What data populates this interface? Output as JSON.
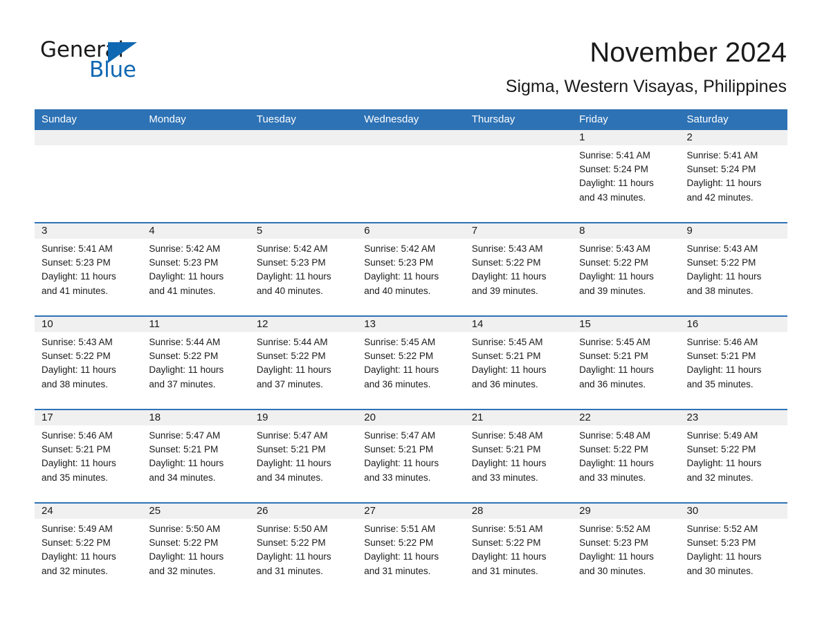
{
  "brand": {
    "name_part1": "General",
    "name_part2": "Blue",
    "accent_color": "#1068b3",
    "triangle_icon": "triangle-icon"
  },
  "header": {
    "title": "November 2024",
    "subtitle": "Sigma, Western Visayas, Philippines"
  },
  "calendar": {
    "header_color": "#2d72b5",
    "weekdays": [
      "Sunday",
      "Monday",
      "Tuesday",
      "Wednesday",
      "Thursday",
      "Friday",
      "Saturday"
    ],
    "weeks": [
      [
        {
          "day": "",
          "sunrise": "",
          "sunset": "",
          "daylight1": "",
          "daylight2": ""
        },
        {
          "day": "",
          "sunrise": "",
          "sunset": "",
          "daylight1": "",
          "daylight2": ""
        },
        {
          "day": "",
          "sunrise": "",
          "sunset": "",
          "daylight1": "",
          "daylight2": ""
        },
        {
          "day": "",
          "sunrise": "",
          "sunset": "",
          "daylight1": "",
          "daylight2": ""
        },
        {
          "day": "",
          "sunrise": "",
          "sunset": "",
          "daylight1": "",
          "daylight2": ""
        },
        {
          "day": "1",
          "sunrise": "Sunrise: 5:41 AM",
          "sunset": "Sunset: 5:24 PM",
          "daylight1": "Daylight: 11 hours",
          "daylight2": "and 43 minutes."
        },
        {
          "day": "2",
          "sunrise": "Sunrise: 5:41 AM",
          "sunset": "Sunset: 5:24 PM",
          "daylight1": "Daylight: 11 hours",
          "daylight2": "and 42 minutes."
        }
      ],
      [
        {
          "day": "3",
          "sunrise": "Sunrise: 5:41 AM",
          "sunset": "Sunset: 5:23 PM",
          "daylight1": "Daylight: 11 hours",
          "daylight2": "and 41 minutes."
        },
        {
          "day": "4",
          "sunrise": "Sunrise: 5:42 AM",
          "sunset": "Sunset: 5:23 PM",
          "daylight1": "Daylight: 11 hours",
          "daylight2": "and 41 minutes."
        },
        {
          "day": "5",
          "sunrise": "Sunrise: 5:42 AM",
          "sunset": "Sunset: 5:23 PM",
          "daylight1": "Daylight: 11 hours",
          "daylight2": "and 40 minutes."
        },
        {
          "day": "6",
          "sunrise": "Sunrise: 5:42 AM",
          "sunset": "Sunset: 5:23 PM",
          "daylight1": "Daylight: 11 hours",
          "daylight2": "and 40 minutes."
        },
        {
          "day": "7",
          "sunrise": "Sunrise: 5:43 AM",
          "sunset": "Sunset: 5:22 PM",
          "daylight1": "Daylight: 11 hours",
          "daylight2": "and 39 minutes."
        },
        {
          "day": "8",
          "sunrise": "Sunrise: 5:43 AM",
          "sunset": "Sunset: 5:22 PM",
          "daylight1": "Daylight: 11 hours",
          "daylight2": "and 39 minutes."
        },
        {
          "day": "9",
          "sunrise": "Sunrise: 5:43 AM",
          "sunset": "Sunset: 5:22 PM",
          "daylight1": "Daylight: 11 hours",
          "daylight2": "and 38 minutes."
        }
      ],
      [
        {
          "day": "10",
          "sunrise": "Sunrise: 5:43 AM",
          "sunset": "Sunset: 5:22 PM",
          "daylight1": "Daylight: 11 hours",
          "daylight2": "and 38 minutes."
        },
        {
          "day": "11",
          "sunrise": "Sunrise: 5:44 AM",
          "sunset": "Sunset: 5:22 PM",
          "daylight1": "Daylight: 11 hours",
          "daylight2": "and 37 minutes."
        },
        {
          "day": "12",
          "sunrise": "Sunrise: 5:44 AM",
          "sunset": "Sunset: 5:22 PM",
          "daylight1": "Daylight: 11 hours",
          "daylight2": "and 37 minutes."
        },
        {
          "day": "13",
          "sunrise": "Sunrise: 5:45 AM",
          "sunset": "Sunset: 5:22 PM",
          "daylight1": "Daylight: 11 hours",
          "daylight2": "and 36 minutes."
        },
        {
          "day": "14",
          "sunrise": "Sunrise: 5:45 AM",
          "sunset": "Sunset: 5:21 PM",
          "daylight1": "Daylight: 11 hours",
          "daylight2": "and 36 minutes."
        },
        {
          "day": "15",
          "sunrise": "Sunrise: 5:45 AM",
          "sunset": "Sunset: 5:21 PM",
          "daylight1": "Daylight: 11 hours",
          "daylight2": "and 36 minutes."
        },
        {
          "day": "16",
          "sunrise": "Sunrise: 5:46 AM",
          "sunset": "Sunset: 5:21 PM",
          "daylight1": "Daylight: 11 hours",
          "daylight2": "and 35 minutes."
        }
      ],
      [
        {
          "day": "17",
          "sunrise": "Sunrise: 5:46 AM",
          "sunset": "Sunset: 5:21 PM",
          "daylight1": "Daylight: 11 hours",
          "daylight2": "and 35 minutes."
        },
        {
          "day": "18",
          "sunrise": "Sunrise: 5:47 AM",
          "sunset": "Sunset: 5:21 PM",
          "daylight1": "Daylight: 11 hours",
          "daylight2": "and 34 minutes."
        },
        {
          "day": "19",
          "sunrise": "Sunrise: 5:47 AM",
          "sunset": "Sunset: 5:21 PM",
          "daylight1": "Daylight: 11 hours",
          "daylight2": "and 34 minutes."
        },
        {
          "day": "20",
          "sunrise": "Sunrise: 5:47 AM",
          "sunset": "Sunset: 5:21 PM",
          "daylight1": "Daylight: 11 hours",
          "daylight2": "and 33 minutes."
        },
        {
          "day": "21",
          "sunrise": "Sunrise: 5:48 AM",
          "sunset": "Sunset: 5:21 PM",
          "daylight1": "Daylight: 11 hours",
          "daylight2": "and 33 minutes."
        },
        {
          "day": "22",
          "sunrise": "Sunrise: 5:48 AM",
          "sunset": "Sunset: 5:22 PM",
          "daylight1": "Daylight: 11 hours",
          "daylight2": "and 33 minutes."
        },
        {
          "day": "23",
          "sunrise": "Sunrise: 5:49 AM",
          "sunset": "Sunset: 5:22 PM",
          "daylight1": "Daylight: 11 hours",
          "daylight2": "and 32 minutes."
        }
      ],
      [
        {
          "day": "24",
          "sunrise": "Sunrise: 5:49 AM",
          "sunset": "Sunset: 5:22 PM",
          "daylight1": "Daylight: 11 hours",
          "daylight2": "and 32 minutes."
        },
        {
          "day": "25",
          "sunrise": "Sunrise: 5:50 AM",
          "sunset": "Sunset: 5:22 PM",
          "daylight1": "Daylight: 11 hours",
          "daylight2": "and 32 minutes."
        },
        {
          "day": "26",
          "sunrise": "Sunrise: 5:50 AM",
          "sunset": "Sunset: 5:22 PM",
          "daylight1": "Daylight: 11 hours",
          "daylight2": "and 31 minutes."
        },
        {
          "day": "27",
          "sunrise": "Sunrise: 5:51 AM",
          "sunset": "Sunset: 5:22 PM",
          "daylight1": "Daylight: 11 hours",
          "daylight2": "and 31 minutes."
        },
        {
          "day": "28",
          "sunrise": "Sunrise: 5:51 AM",
          "sunset": "Sunset: 5:22 PM",
          "daylight1": "Daylight: 11 hours",
          "daylight2": "and 31 minutes."
        },
        {
          "day": "29",
          "sunrise": "Sunrise: 5:52 AM",
          "sunset": "Sunset: 5:23 PM",
          "daylight1": "Daylight: 11 hours",
          "daylight2": "and 30 minutes."
        },
        {
          "day": "30",
          "sunrise": "Sunrise: 5:52 AM",
          "sunset": "Sunset: 5:23 PM",
          "daylight1": "Daylight: 11 hours",
          "daylight2": "and 30 minutes."
        }
      ]
    ]
  }
}
